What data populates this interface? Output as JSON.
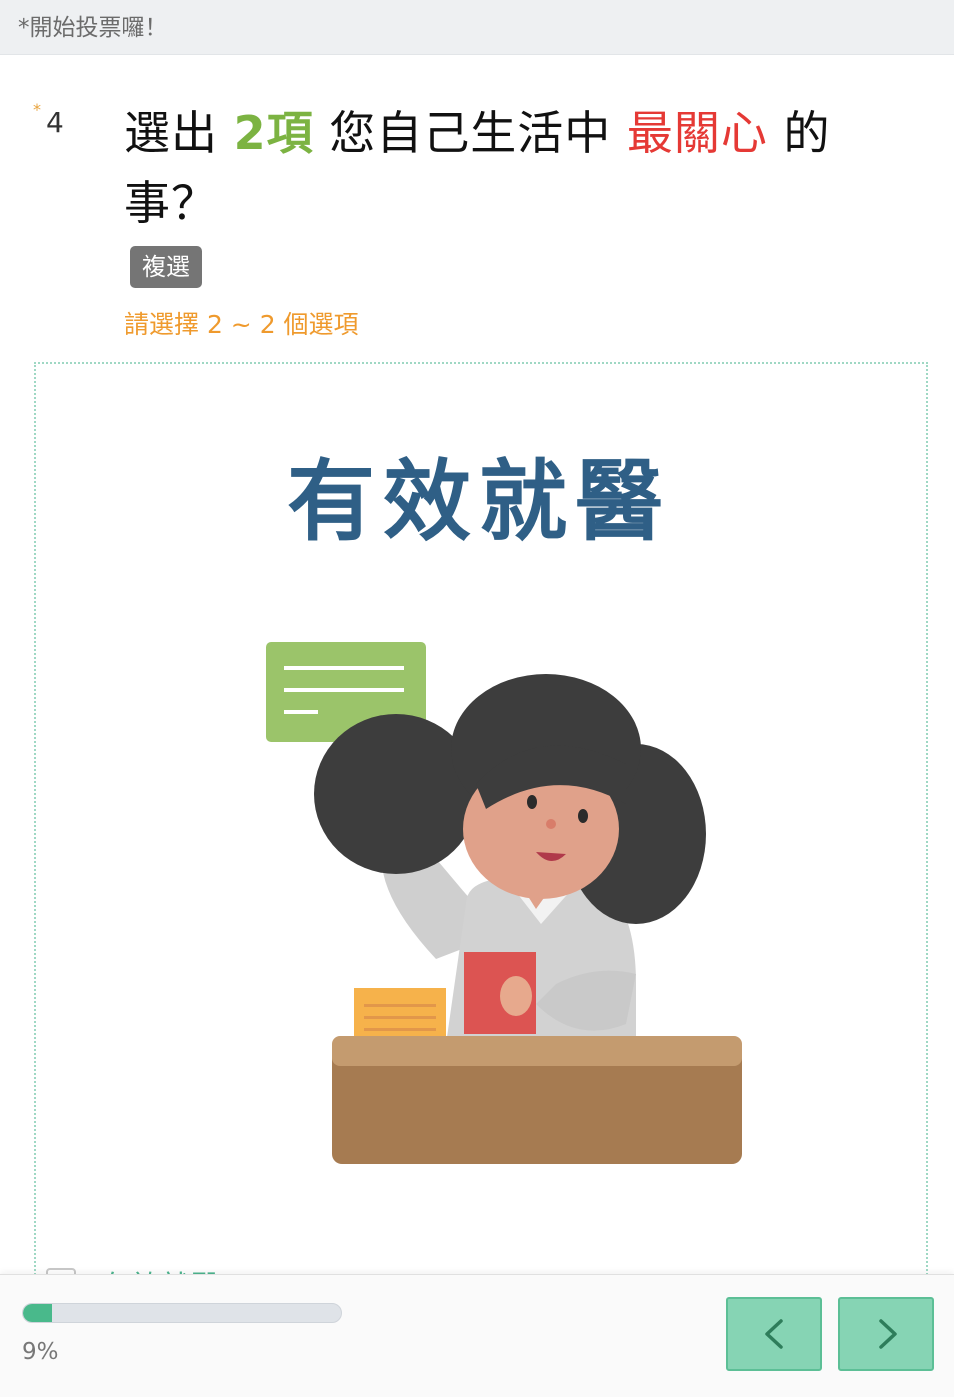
{
  "banner": {
    "text": "*開始投票囉！"
  },
  "question": {
    "required_mark": "*",
    "number": "4",
    "title_parts": [
      "選出 ",
      "2項",
      " 您自己生活中 ",
      "最關心",
      " 的事？"
    ],
    "type_tag": "複選",
    "hint": "請選擇 2 ~ 2 個選項"
  },
  "option": {
    "image_heading": "有效就醫",
    "label": "有效就醫"
  },
  "progress": {
    "value": 0.09,
    "label": "9%"
  },
  "colors": {
    "accent": "#49b98b",
    "highlight_green": "#7cb342",
    "highlight_red": "#e53935",
    "hint": "#ef9a2d"
  },
  "icons": {
    "prev": "chevron-left-icon",
    "next": "chevron-right-icon"
  }
}
